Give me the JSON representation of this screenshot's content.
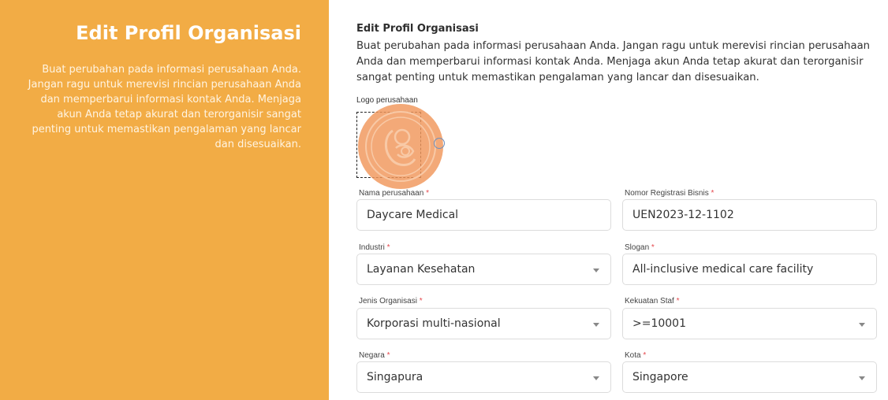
{
  "sidebar": {
    "title": "Edit Profil Organisasi",
    "description": "Buat perubahan pada informasi perusahaan Anda. Jangan ragu untuk merevisi rincian perusahaan Anda dan memperbarui informasi kontak Anda. Menjaga akun Anda tetap akurat dan terorganisir sangat penting untuk memastikan pengalaman yang lancar dan disesuaikan."
  },
  "main": {
    "title": "Edit Profil Organisasi",
    "description": "Buat perubahan pada informasi perusahaan Anda. Jangan ragu untuk merevisi rincian perusahaan Anda dan memperbarui informasi kontak Anda. Menjaga akun Anda tetap akurat dan terorganisir sangat penting untuk memastikan pengalaman yang lancar dan disesuaikan."
  },
  "logo": {
    "label": "Logo perusahaan",
    "icon": "mother-baby-logo-icon",
    "edit_icon": "edit-circle-icon"
  },
  "form": {
    "required_mark": "*",
    "company_name": {
      "label": "Nama perusahaan",
      "value": "Daycare Medical"
    },
    "business_reg": {
      "label": "Nomor Registrasi Bisnis",
      "value": "UEN2023-12-1102"
    },
    "industry": {
      "label": "Industri",
      "value": "Layanan Kesehatan"
    },
    "slogan": {
      "label": "Slogan",
      "value": "All-inclusive medical care facility"
    },
    "org_type": {
      "label": "Jenis Organisasi",
      "value": "Korporasi multi-nasional"
    },
    "staff_strength": {
      "label": "Kekuatan Staf",
      "value": ">=10001"
    },
    "country": {
      "label": "Negara",
      "value": "Singapura"
    },
    "city": {
      "label": "Kota",
      "value": "Singapore"
    }
  },
  "colors": {
    "accent": "#f2ac45",
    "required": "#e5484d"
  }
}
